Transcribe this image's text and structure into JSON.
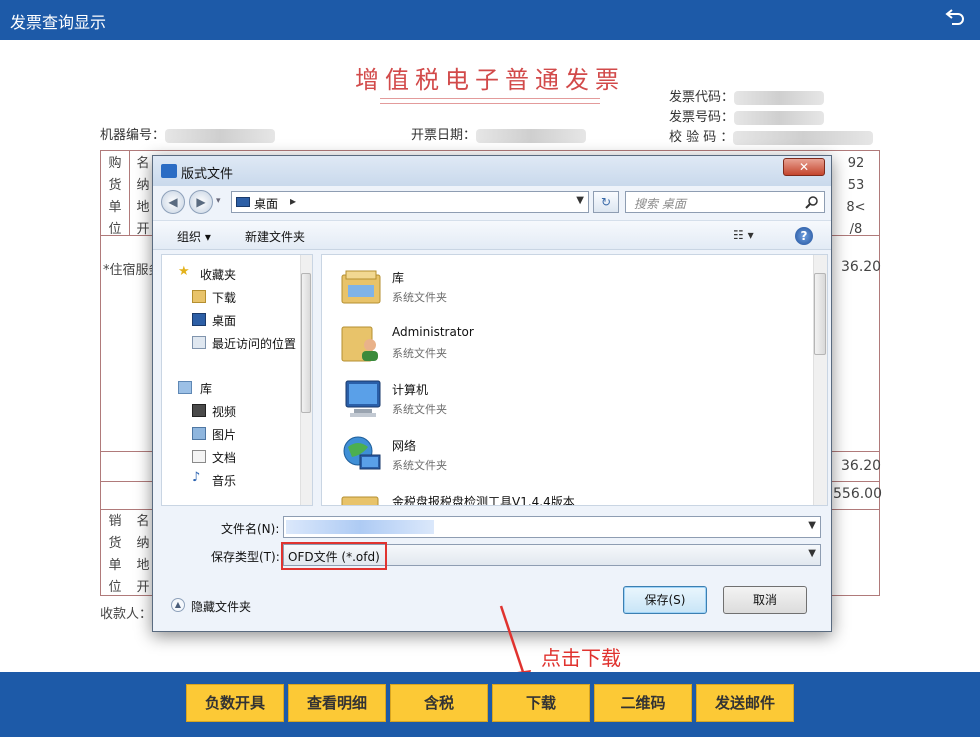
{
  "app": {
    "title": "发票查询显示"
  },
  "invoice": {
    "title": "增值税电子普通发票",
    "fields": {
      "code_label": "发票代码：",
      "number_label": "发票号码：",
      "check_label": "校 验 码 ：",
      "machine_label": "机器编号：",
      "date_label": "开票日期："
    },
    "buyer_labels": [
      "购",
      "货",
      "单",
      "位"
    ],
    "buyer_rows": [
      "名",
      "纳",
      "地",
      "开"
    ],
    "seller_labels": [
      "销",
      "货",
      "单",
      "位"
    ],
    "seller_rows": [
      "名",
      "纳",
      "地",
      "开"
    ],
    "right_values": [
      "92",
      "53",
      "8<",
      "/8"
    ],
    "item_note": "*住宿服务",
    "amount_1": "36.20",
    "amount_2": "36.20",
    "total": "556.00",
    "payee_label": "收款人："
  },
  "dialog": {
    "title": "版式文件",
    "close_label": "✕",
    "address": "桌面",
    "search_placeholder": "搜索 桌面",
    "toolbar": {
      "organize": "组织 ▾",
      "new_folder": "新建文件夹"
    },
    "nav_pane": [
      {
        "label": "收藏夹",
        "icon": "star-icon"
      },
      {
        "label": "下载",
        "icon": "download-folder-icon"
      },
      {
        "label": "桌面",
        "icon": "desktop-icon"
      },
      {
        "label": "最近访问的位置",
        "icon": "recent-places-icon"
      },
      {
        "label": "库",
        "icon": "library-icon"
      },
      {
        "label": "视频",
        "icon": "video-icon"
      },
      {
        "label": "图片",
        "icon": "picture-icon"
      },
      {
        "label": "文档",
        "icon": "document-icon"
      },
      {
        "label": "音乐",
        "icon": "music-icon"
      }
    ],
    "files": [
      {
        "name": "库",
        "type": "系统文件夹",
        "icon": "library-folder-icon"
      },
      {
        "name": "Administrator",
        "type": "系统文件夹",
        "icon": "user-folder-icon"
      },
      {
        "name": "计算机",
        "type": "系统文件夹",
        "icon": "computer-icon"
      },
      {
        "name": "网络",
        "type": "系统文件夹",
        "icon": "network-icon"
      },
      {
        "name": "金税盘报税盘检测工具V1.4.4版本",
        "type": "",
        "icon": "folder-icon"
      }
    ],
    "filename_label": "文件名(N):",
    "filetype_label": "保存类型(T):",
    "filetype_value": "OFD文件 (*.ofd)",
    "hide_folders": "隐藏文件夹",
    "save_button": "保存(S)",
    "cancel_button": "取消"
  },
  "annotation": {
    "text": "点击下载"
  },
  "bottom_buttons": {
    "negative": "负数开具",
    "details": "查看明细",
    "tax_included": "含税",
    "download": "下载",
    "qrcode": "二维码",
    "send_email": "发送邮件"
  },
  "colors": {
    "app_blue": "#1d5aa8",
    "button_yellow": "#fcc936",
    "invoice_red": "#d24a4a",
    "annotation_red": "#e0332f"
  }
}
